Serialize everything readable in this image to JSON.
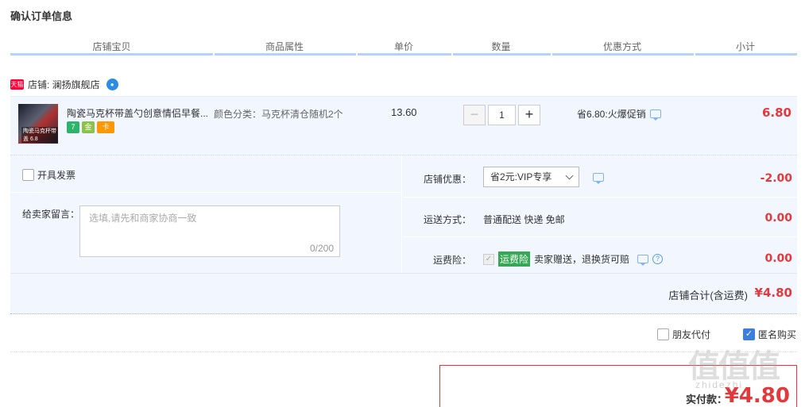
{
  "page": {
    "title": "确认订单信息"
  },
  "columns": [
    "店铺宝贝",
    "商品属性",
    "单价",
    "数量",
    "优惠方式",
    "小计"
  ],
  "shop": {
    "badge": "天猫",
    "name": "店铺: 澜扬旗舰店"
  },
  "item": {
    "thumb_label": "陶瓷马克杯带盖 6.8",
    "title": "陶瓷马克杯带盖勺创意情侣早餐...",
    "badges": [
      "7",
      "金",
      "卡"
    ],
    "attribute": "颜色分类：马克杯清仓随机2个",
    "unit_price": "13.60",
    "quantity": "1",
    "qty_minus": "−",
    "qty_plus": "+",
    "promotion": "省6.80:火爆促销",
    "subtotal": "6.80"
  },
  "invoice": {
    "label": "开具发票"
  },
  "message": {
    "label": "给卖家留言：",
    "placeholder": "选填,请先和商家协商一致",
    "counter": "0/200"
  },
  "store_discount": {
    "label": "店铺优惠：",
    "selected": "省2元:VIP专享",
    "amount": "-2.00"
  },
  "shipping": {
    "label": "运送方式：",
    "value": "普通配送 快递 免邮",
    "amount": "0.00"
  },
  "insurance": {
    "label": "运费险：",
    "tag": "运费险",
    "text": "卖家赠送，退换货可赔",
    "amount": "0.00"
  },
  "shop_total": {
    "label": "店铺合计(含运费)",
    "amount": "¥4.80"
  },
  "options": {
    "friend_pay": "朋友代付",
    "anonymous": "匿名购买"
  },
  "payment": {
    "label": "实付款：",
    "amount": "¥4.80"
  },
  "watermark": {
    "text": "值值值",
    "sub": "zhidezhi"
  }
}
